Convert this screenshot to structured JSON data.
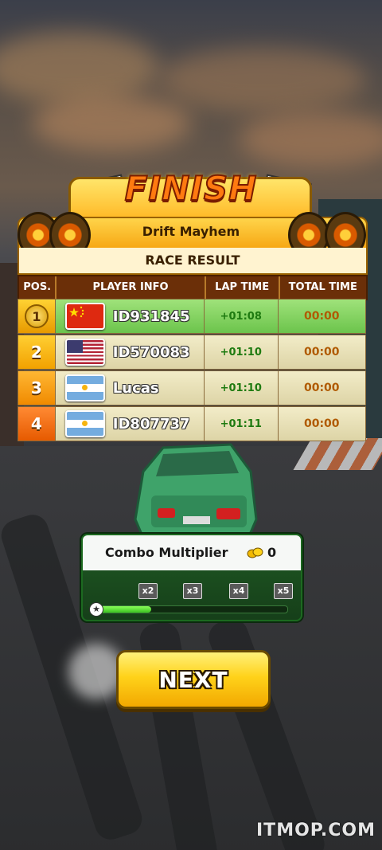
{
  "banner": {
    "title": "FINISH",
    "event_name": "Drift Mayhem",
    "subtitle": "RACE RESULT"
  },
  "table": {
    "headers": [
      "POS.",
      "PLAYER INFO",
      "LAP TIME",
      "TOTAL TIME"
    ],
    "rows": [
      {
        "pos": "1",
        "flag": "china-flag-icon",
        "name": "ID931845",
        "lap": "+01:08",
        "total": "00:00"
      },
      {
        "pos": "2",
        "flag": "usa-flag-icon",
        "name": "ID570083",
        "lap": "+01:10",
        "total": "00:00"
      },
      {
        "pos": "3",
        "flag": "argentina-flag-icon",
        "name": "Lucas",
        "lap": "+01:10",
        "total": "00:00"
      },
      {
        "pos": "4",
        "flag": "argentina-flag-icon",
        "name": "ID807737",
        "lap": "+01:11",
        "total": "00:00"
      }
    ]
  },
  "combo": {
    "title": "Combo Multiplier",
    "value": "0",
    "multipliers": [
      "x2",
      "x3",
      "x4",
      "x5"
    ],
    "progress_fraction": 0.28
  },
  "next_button": {
    "label": "NEXT"
  },
  "watermark": "ITMOP.COM",
  "colors": {
    "accent": "#ffd21a",
    "first_row": "#6cc44c",
    "header_bar": "#6b2f08",
    "combo_panel": "#1f5a24"
  }
}
